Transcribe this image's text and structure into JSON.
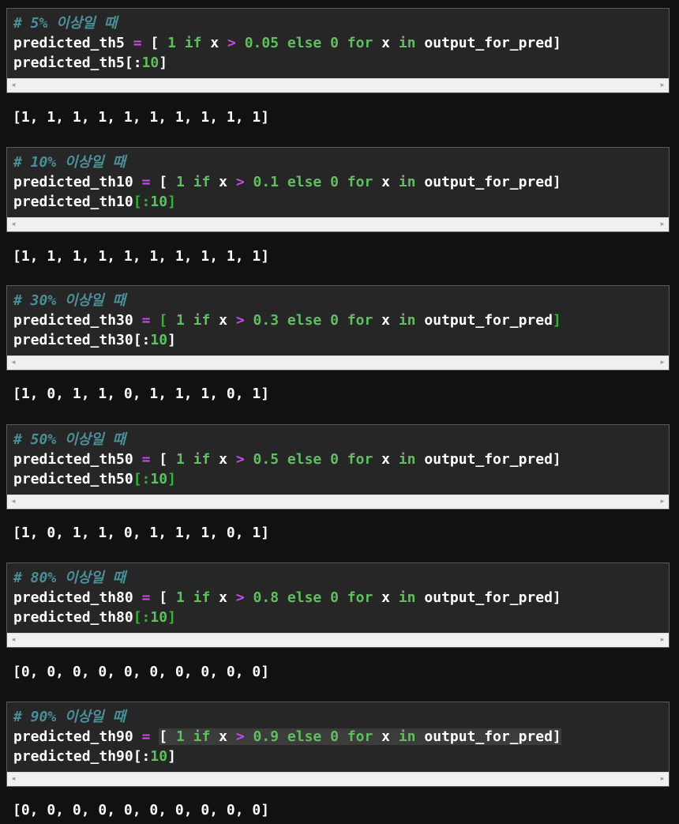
{
  "cells": [
    {
      "comment": "# 5% 이상일 때",
      "var_assign": "predicted_th5",
      "eq": "=",
      "open_bracket": "[",
      "num1": "1",
      "kw_if": "if",
      "x1": "x",
      "gt": ">",
      "threshold": "0.05",
      "kw_else": "else",
      "num0": "0",
      "kw_for": "for",
      "x2": "x",
      "kw_in": "in",
      "iter": "output_for_pred",
      "close_bracket": "]",
      "var_slice": "predicted_th5",
      "slice_open": "[:",
      "slice_num": "10",
      "slice_close": "]",
      "output": "[1, 1, 1, 1, 1, 1, 1, 1, 1, 1]"
    },
    {
      "comment": "# 10% 이상일 때",
      "var_assign": "predicted_th10",
      "eq": "=",
      "open_bracket": "[",
      "num1": "1",
      "kw_if": "if",
      "x1": "x",
      "gt": ">",
      "threshold": "0.1",
      "kw_else": "else",
      "num0": "0",
      "kw_for": "for",
      "x2": "x",
      "kw_in": "in",
      "iter": "output_for_pred",
      "close_bracket": "]",
      "var_slice": "predicted_th10",
      "slice_open": "[:",
      "slice_num": "10",
      "slice_close": "]",
      "output": "[1, 1, 1, 1, 1, 1, 1, 1, 1, 1]"
    },
    {
      "comment": "# 30% 이상일 때",
      "var_assign": "predicted_th30",
      "eq": "=",
      "open_bracket": "[",
      "num1": "1",
      "kw_if": "if",
      "x1": "x",
      "gt": ">",
      "threshold": "0.3",
      "kw_else": "else",
      "num0": "0",
      "kw_for": "for",
      "x2": "x",
      "kw_in": "in",
      "iter": "output_for_pred",
      "close_bracket": "]",
      "var_slice": "predicted_th30",
      "slice_open": "[:",
      "slice_num": "10",
      "slice_close": "]",
      "output": "[1, 0, 1, 1, 0, 1, 1, 1, 0, 1]"
    },
    {
      "comment": "# 50% 이상일 때",
      "var_assign": "predicted_th50",
      "eq": "=",
      "open_bracket": "[",
      "num1": "1",
      "kw_if": "if",
      "x1": "x",
      "gt": ">",
      "threshold": "0.5",
      "kw_else": "else",
      "num0": "0",
      "kw_for": "for",
      "x2": "x",
      "kw_in": "in",
      "iter": "output_for_pred",
      "close_bracket": "]",
      "var_slice": "predicted_th50",
      "slice_open": "[:",
      "slice_num": "10",
      "slice_close": "]",
      "output": "[1, 0, 1, 1, 0, 1, 1, 1, 0, 1]"
    },
    {
      "comment": "# 80% 이상일 때",
      "var_assign": "predicted_th80",
      "eq": "=",
      "open_bracket": "[",
      "num1": "1",
      "kw_if": "if",
      "x1": "x",
      "gt": ">",
      "threshold": "0.8",
      "kw_else": "else",
      "num0": "0",
      "kw_for": "for",
      "x2": "x",
      "kw_in": "in",
      "iter": "output_for_pred",
      "close_bracket": "]",
      "var_slice": "predicted_th80",
      "slice_open": "[:",
      "slice_num": "10",
      "slice_close": "]",
      "output": "[0, 0, 0, 0, 0, 0, 0, 0, 0, 0]"
    },
    {
      "comment": "# 90% 이상일 때",
      "var_assign": "predicted_th90",
      "eq": "=",
      "open_bracket": "[",
      "num1": "1",
      "kw_if": "if",
      "x1": "x",
      "gt": ">",
      "threshold": "0.9",
      "kw_else": "else",
      "num0": "0",
      "kw_for": "for",
      "x2": "x",
      "kw_in": "in",
      "iter": "output_for_pred",
      "close_bracket": "]",
      "var_slice": "predicted_th90",
      "slice_open": "[:",
      "slice_num": "10",
      "slice_close": "]",
      "output": "[0, 0, 0, 0, 0, 0, 0, 0, 0, 0]"
    }
  ],
  "scrollbar": {
    "left_arrow": "◂",
    "right_arrow": "▸"
  },
  "colors": {
    "background": "#111111",
    "cell_background": "#262626",
    "comment": "#4a8f99",
    "keyword": "#5fbf5f",
    "operator": "#c14ee6",
    "bracket_match": "#2fb82f"
  }
}
